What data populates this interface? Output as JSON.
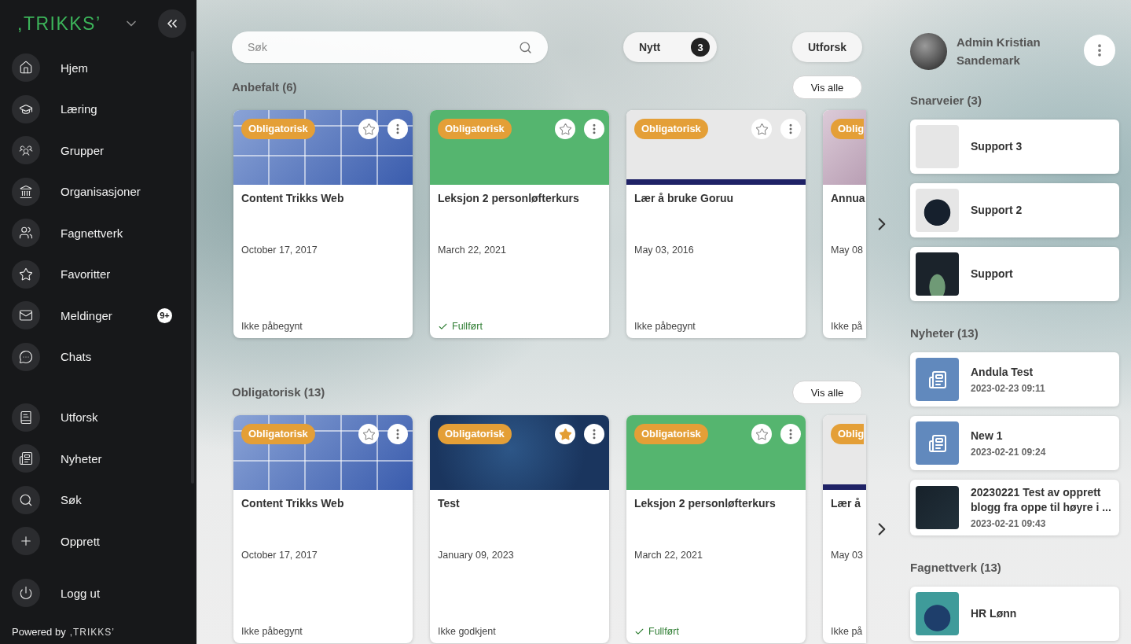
{
  "sidebar": {
    "logo": ",TRIKKS’",
    "nav": [
      {
        "label": "Hjem"
      },
      {
        "label": "Læring"
      },
      {
        "label": "Grupper"
      },
      {
        "label": "Organisasjoner"
      },
      {
        "label": "Fagnettverk"
      },
      {
        "label": "Favoritter"
      },
      {
        "label": "Meldinger",
        "badge": "9+"
      },
      {
        "label": "Chats"
      }
    ],
    "secondary_nav": [
      {
        "label": "Utforsk"
      },
      {
        "label": "Nyheter"
      },
      {
        "label": "Søk"
      },
      {
        "label": "Opprett"
      }
    ],
    "logout": {
      "label": "Logg ut"
    },
    "footer": {
      "text": "Powered by",
      "logo": ",TRIKKS’"
    }
  },
  "header": {
    "search": {
      "placeholder": "Søk"
    },
    "new_button": {
      "label": "Nytt",
      "count": "3"
    },
    "explore_button": {
      "label": "Utforsk"
    }
  },
  "sections": [
    {
      "title": "Anbefalt (6)",
      "action": "Vis alle",
      "cards": [
        {
          "kind": "grid",
          "tag": "Obligatorisk",
          "starred": false,
          "title": "Content Trikks Web",
          "date": "October 17, 2017",
          "status": "Ikke påbegynt",
          "completed": false
        },
        {
          "kind": "green",
          "tag": "Obligatorisk",
          "starred": false,
          "title": "Leksjon 2 personløfterkurs",
          "date": "March 22, 2021",
          "status": "Fullført",
          "completed": true
        },
        {
          "kind": "office",
          "tag": "Obligatorisk",
          "starred": false,
          "title": "Lær å bruke Goruu",
          "date": "May 03, 2016",
          "status": "Ikke påbegynt",
          "completed": false
        },
        {
          "kind": "pink",
          "tag": "Oblig",
          "title": "Annua",
          "date": "May 08",
          "status": "Ikke på",
          "completed": false
        }
      ]
    },
    {
      "title": "Obligatorisk (13)",
      "action": "Vis alle",
      "cards": [
        {
          "kind": "grid",
          "tag": "Obligatorisk",
          "starred": false,
          "title": "Content Trikks Web",
          "date": "October 17, 2017",
          "status": "Ikke påbegynt",
          "completed": false
        },
        {
          "kind": "space",
          "tag": "Obligatorisk",
          "starred": true,
          "title": "Test",
          "date": "January 09, 2023",
          "status": "Ikke godkjent",
          "completed": false
        },
        {
          "kind": "green",
          "tag": "Obligatorisk",
          "starred": false,
          "title": "Leksjon 2 personløfterkurs",
          "date": "March 22, 2021",
          "status": "Fullført",
          "completed": true
        },
        {
          "kind": "office",
          "tag": "Oblig",
          "title": "Lær å",
          "date": "May 03",
          "status": "Ikke på",
          "completed": false
        }
      ]
    }
  ],
  "profile": {
    "name": "Admin Kristian Sandemark"
  },
  "panels": [
    {
      "title": "Snarveier (3)",
      "items": [
        {
          "kind": "light",
          "title": "Support 3"
        },
        {
          "kind": "blob",
          "title": "Support 2"
        },
        {
          "kind": "dark",
          "title": "Support"
        }
      ]
    },
    {
      "title": "Nyheter (13)",
      "items": [
        {
          "kind": "news",
          "title": "Andula Test",
          "date": "2023-02-23 09:11"
        },
        {
          "kind": "news",
          "title": "New 1",
          "date": "2023-02-21 09:24"
        },
        {
          "kind": "night",
          "title": "20230221 Test av opprett blogg fra oppe til høyre i ...",
          "date": "2023-02-21 09:43"
        }
      ]
    },
    {
      "title": "Fagnettverk (13)",
      "items": [
        {
          "kind": "teal",
          "title": "HR Lønn"
        }
      ]
    }
  ]
}
